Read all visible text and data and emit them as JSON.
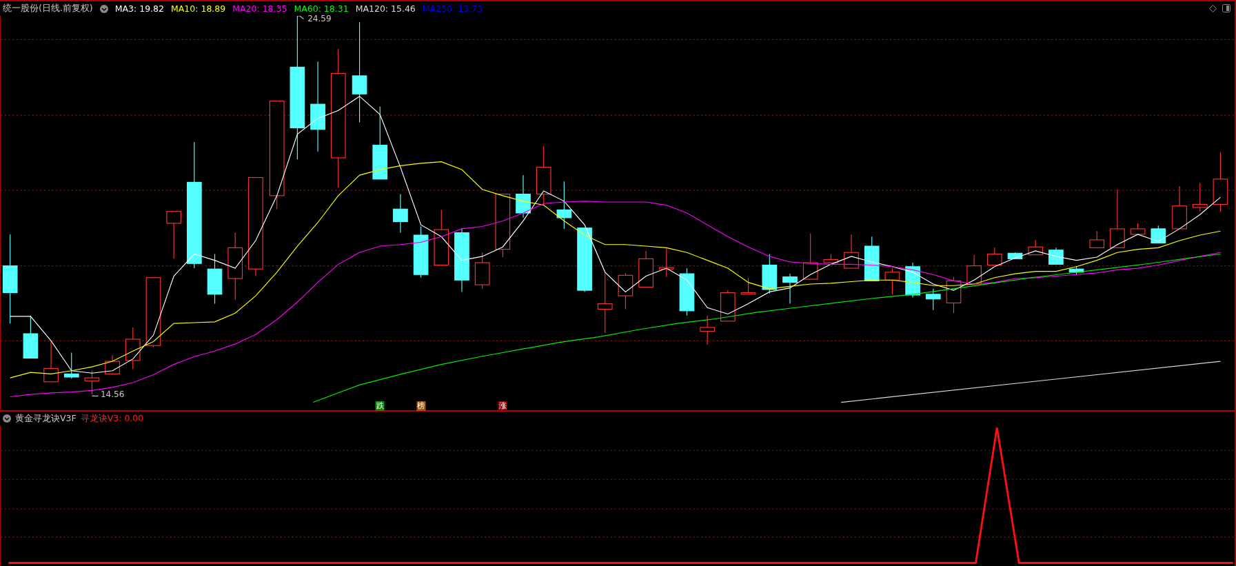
{
  "main_panel": {
    "title": "统一股份",
    "period": "(日线.前复权)",
    "moving_averages": [
      {
        "label": "MA3: 19.82",
        "color": "#ffffff"
      },
      {
        "label": "MA10: 18.89",
        "color": "#ffff00"
      },
      {
        "label": "MA20: 18.35",
        "color": "#ff00ff"
      },
      {
        "label": "MA60: 18.31",
        "color": "#00ff00"
      },
      {
        "label": "MA120: 15.46",
        "color": "#dddddd"
      },
      {
        "label": "MA250: 13.73",
        "color": "#0000ff"
      }
    ],
    "high_label": "24.59",
    "low_label": "14.56",
    "signals": [
      {
        "text": "跌",
        "color": "#0a8a0a"
      },
      {
        "text": "榜",
        "color": "#9a5a10"
      },
      {
        "text": "涨",
        "color": "#8a0a0a"
      }
    ]
  },
  "indicator_panel": {
    "name": "黄金寻龙诀V3F",
    "reading": "寻龙诀V3: 0.00"
  }
}
